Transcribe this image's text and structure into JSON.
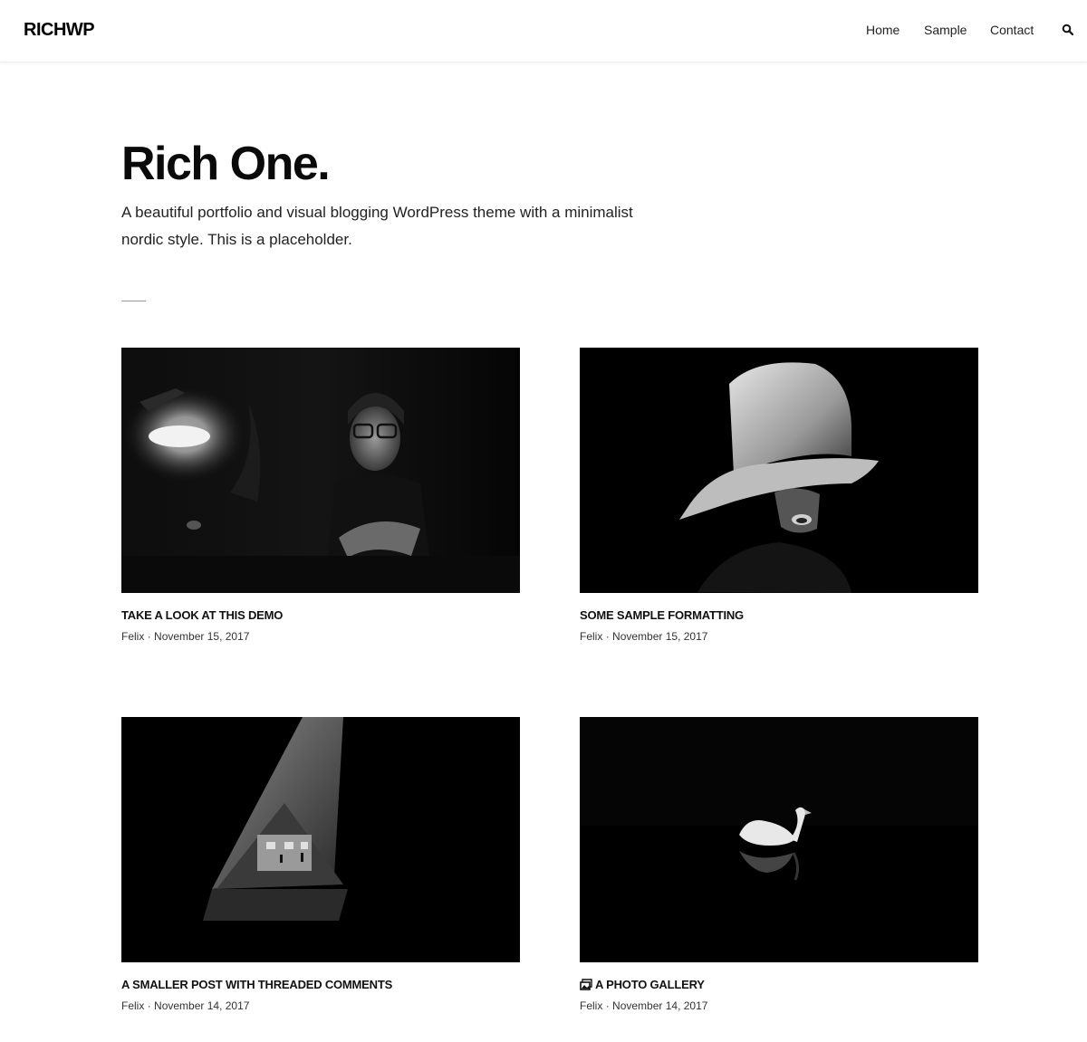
{
  "header": {
    "logo": "RICHWP",
    "nav": [
      "Home",
      "Sample",
      "Contact"
    ],
    "search_icon": "search-icon"
  },
  "hero": {
    "title": "Rich One.",
    "description": "A beautiful portfolio and visual blogging WordPress theme with a minimalist nordic style. This is a placeholder."
  },
  "posts": [
    {
      "title": "TAKE A LOOK AT THIS DEMO",
      "author": "Felix",
      "separator": "·",
      "date": "November 15, 2017",
      "image": "woman-with-glasses-at-lamp-photo"
    },
    {
      "title": "SOME SAMPLE FORMATTING",
      "author": "Felix",
      "separator": "·",
      "date": "November 15, 2017",
      "image": "figure-in-bucket-hat-photo"
    },
    {
      "title": "A SMALLER POST WITH THREADED COMMENTS",
      "author": "Felix",
      "separator": "·",
      "date": "November 14, 2017",
      "image": "triangle-architecture-photo"
    },
    {
      "title": "A PHOTO GALLERY",
      "author": "Felix",
      "separator": "·",
      "date": "November 14, 2017",
      "image": "swan-on-dark-water-photo",
      "format_icon": "gallery-icon"
    }
  ]
}
